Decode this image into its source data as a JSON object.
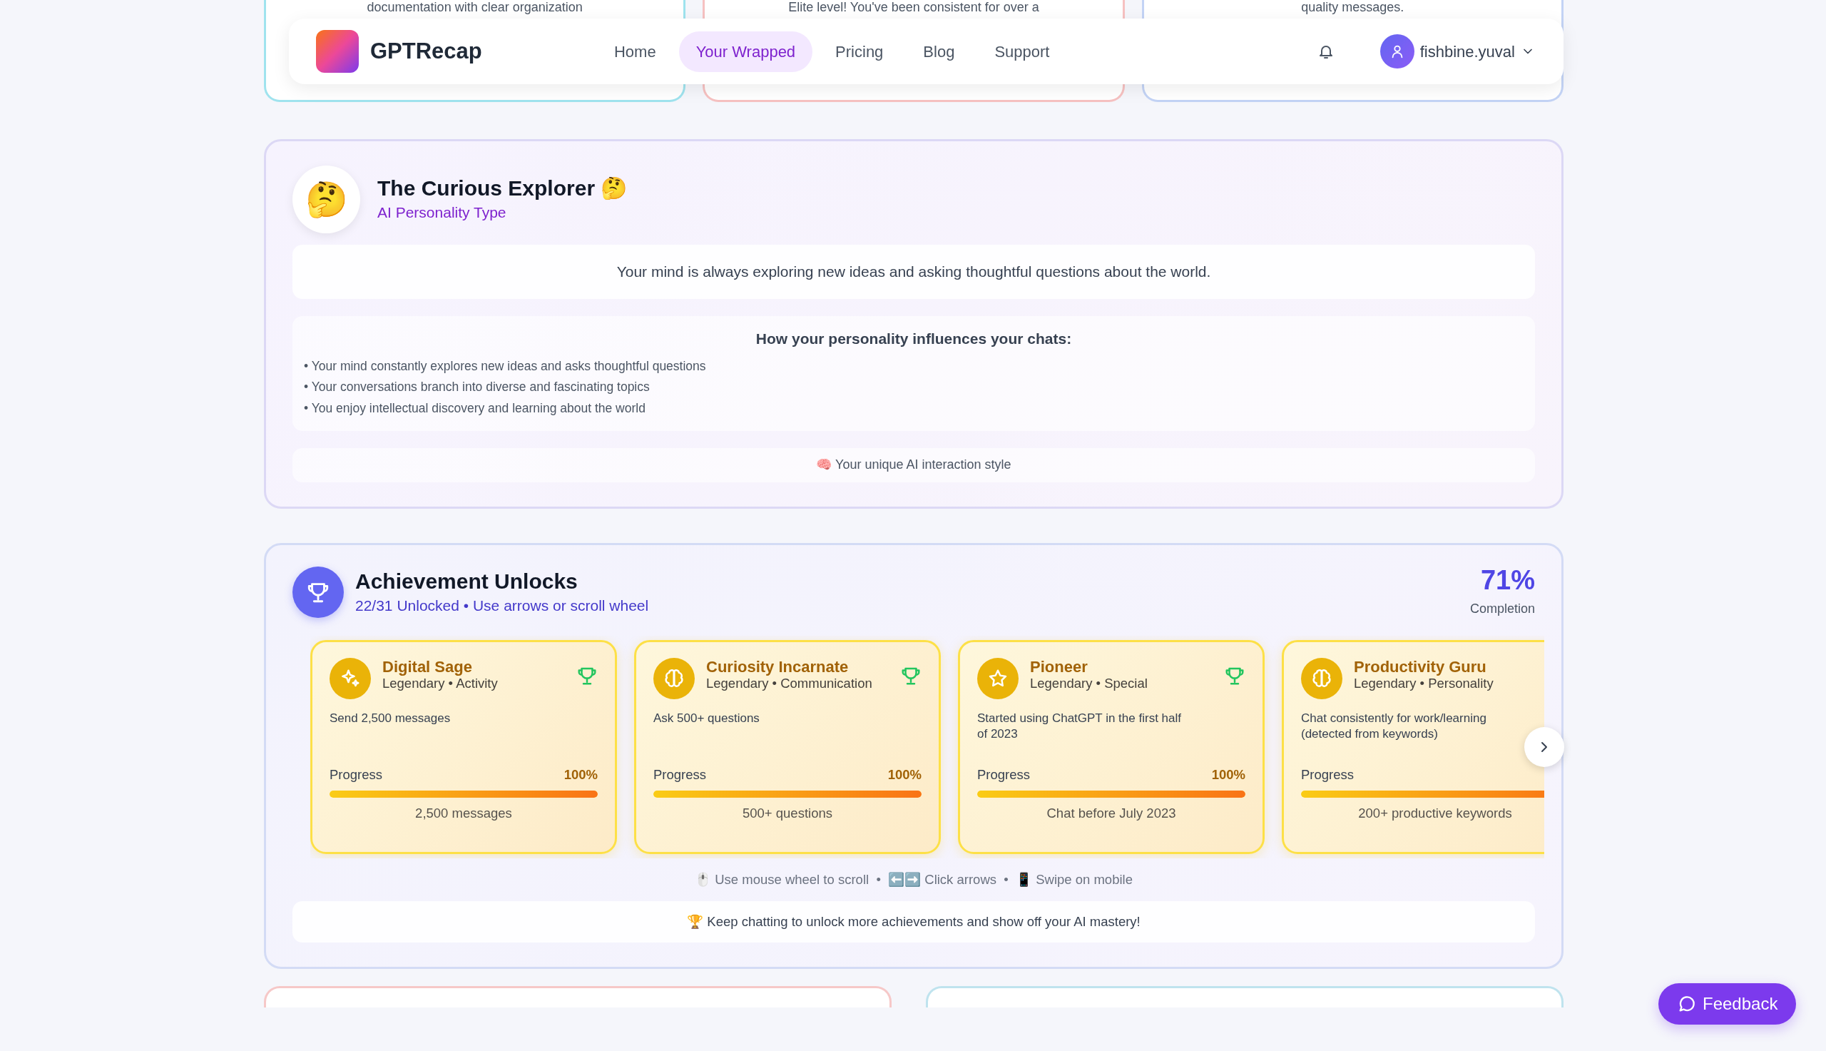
{
  "top_cards": [
    {
      "text": "documentation with clear organization",
      "color": "#9fe3ee"
    },
    {
      "text": "Elite level! You've been consistent for over a",
      "color": "#f6c1c1"
    },
    {
      "text": "quality messages.",
      "color": "#c3d3f5"
    }
  ],
  "navbar": {
    "brand": "GPTRecap",
    "links": [
      {
        "label": "Home",
        "selected": false
      },
      {
        "label": "Your Wrapped",
        "selected": true
      },
      {
        "label": "Pricing",
        "selected": false
      },
      {
        "label": "Blog",
        "selected": false
      },
      {
        "label": "Support",
        "selected": false
      }
    ],
    "user": "fishbine.yuval"
  },
  "personality": {
    "avatar": "🤔",
    "title": "The Curious Explorer 🤔",
    "subtitle": "AI Personality Type",
    "description": "Your mind is always exploring new ideas and asking thoughtful questions about the world.",
    "influence_title": "How your personality influences your chats:",
    "influences": [
      "• Your mind constantly explores new ideas and asks thoughtful questions",
      "• Your conversations branch into diverse and fascinating topics",
      "• You enjoy intellectual discovery and learning about the world"
    ],
    "footer": "🧠 Your unique AI interaction style"
  },
  "achievements": {
    "title": "Achievement Unlocks",
    "subtitle": "22/31 Unlocked • Use arrows or scroll wheel",
    "percent": "71%",
    "percent_label": "Completion",
    "items": [
      {
        "kind": "sparkles",
        "name": "Digital Sage",
        "meta": "Legendary • Activity",
        "description": "Send 2,500 messages",
        "progress_label": "Progress",
        "percent": "100%",
        "level": 1,
        "target": "2,500 messages",
        "unlocked": true
      },
      {
        "kind": "brain",
        "name": "Curiosity Incarnate",
        "meta": "Legendary • Communication",
        "description": "Ask 500+ questions",
        "progress_label": "Progress",
        "percent": "100%",
        "level": 1,
        "target": "500+ questions",
        "unlocked": true
      },
      {
        "kind": "star",
        "name": "Pioneer",
        "meta": "Legendary • Special",
        "description": "Started using ChatGPT in the first half of 2023",
        "progress_label": "Progress",
        "percent": "100%",
        "level": 1,
        "target": "Chat before July 2023",
        "unlocked": true
      },
      {
        "kind": "brain",
        "name": "Productivity Guru",
        "meta": "Legendary • Personality",
        "description": "Chat consistently for work/learning (detected from keywords)",
        "progress_label": "Progress",
        "level": 1,
        "target": "200+ productive keywords"
      }
    ],
    "hints": "🖱️ Use mouse wheel to scroll  •  ⬅️➡️ Click arrows  •  📱 Swipe on mobile",
    "footer": "🏆 Keep chatting to unlock more achievements and show off your AI mastery!"
  },
  "feedback": "Feedback"
}
